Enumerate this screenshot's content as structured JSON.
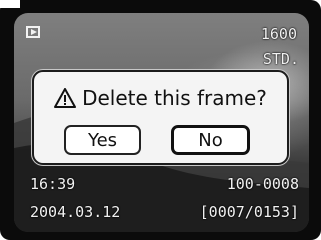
{
  "osd": {
    "mode_icon": "playback-icon",
    "iso": "1600",
    "quality": "STD.",
    "time": "16:39",
    "file_number": "100-0008",
    "date": "2004.03.12",
    "frame_counter": "[0007/0153]"
  },
  "dialog": {
    "icon": "warning-triangle-icon",
    "message": "Delete this frame?",
    "yes_label": "Yes",
    "no_label": "No",
    "selected": "No"
  }
}
